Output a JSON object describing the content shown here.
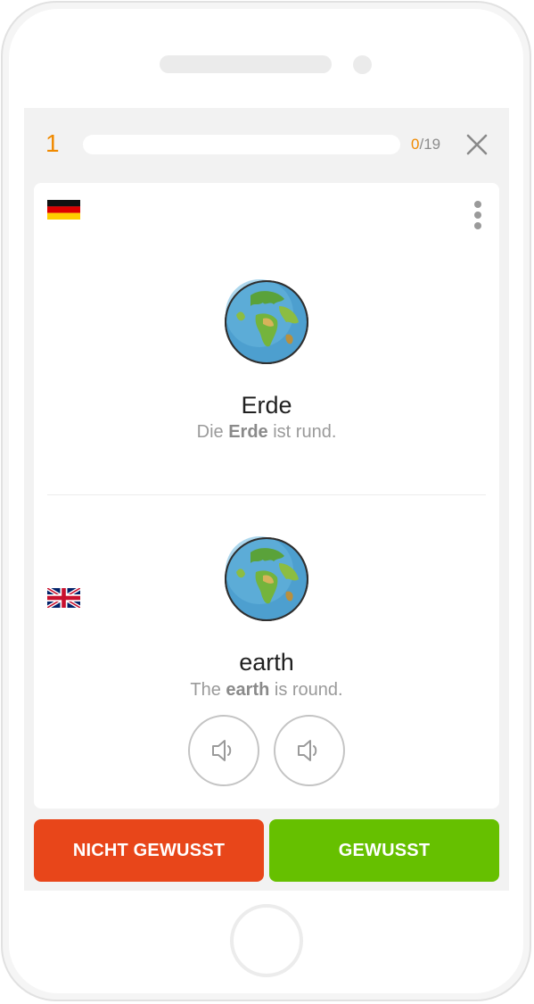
{
  "header": {
    "counter": "1",
    "progress_fraction": 0,
    "progress_done": "0",
    "progress_total": "/19"
  },
  "icons": {
    "close": "close-icon",
    "menu": "more-vertical-icon",
    "audio": "speaker-icon",
    "image": "globe-earth-illustration"
  },
  "source": {
    "language_flag": "flag-germany",
    "word": "Erde",
    "sentence_before": "Die ",
    "sentence_highlight": "Erde",
    "sentence_after": " ist rund."
  },
  "target": {
    "language_flag": "flag-united-kingdom",
    "word": "earth",
    "sentence_before": "The ",
    "sentence_highlight": "earth",
    "sentence_after": " is round."
  },
  "actions": {
    "not_known_label": "NICHT GEWUSST",
    "known_label": "GEWUSST"
  },
  "colors": {
    "accent": "#f08a00",
    "not_known": "#e8461a",
    "known": "#66c000"
  }
}
